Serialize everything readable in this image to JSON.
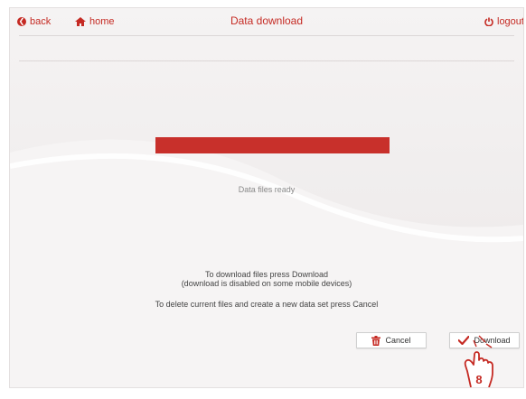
{
  "topbar": {
    "back_label": "back",
    "home_label": "home",
    "title": "Data download",
    "logout_label": "logout"
  },
  "progress": {
    "fraction": 1.0,
    "fill_color": "#c8302b"
  },
  "status_text": "Data files ready",
  "instructions": {
    "line1": "To download files press Download",
    "line2": "(download is disabled on some mobile devices)",
    "line3": "To delete current files and create a new data set press Cancel"
  },
  "buttons": {
    "cancel_label": "Cancel",
    "download_label": "Download"
  },
  "callout": {
    "number": "8"
  },
  "colors": {
    "accent": "#c52a23"
  },
  "icons": [
    "back-icon",
    "home-icon",
    "power-icon",
    "trash-icon",
    "checkmark-icon",
    "pointing-hand-icon"
  ]
}
